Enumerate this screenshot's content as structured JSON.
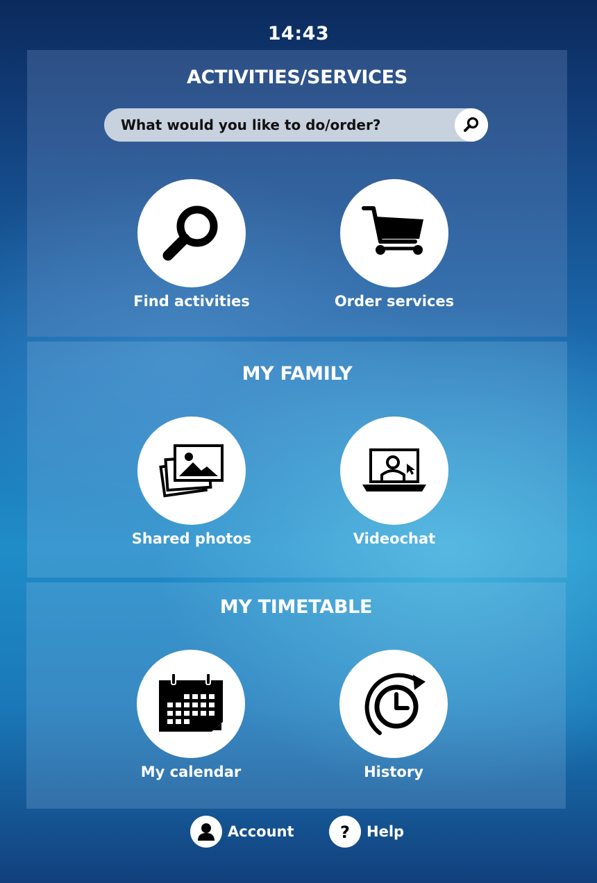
{
  "clock": "14:43",
  "sections": {
    "activities": {
      "title": "ACTIVITIES/SERVICES",
      "search_placeholder": "What would you like to do/order?",
      "tiles": [
        {
          "label": "Find activities",
          "icon": "magnifier-icon"
        },
        {
          "label": "Order services",
          "icon": "shopping-cart-icon"
        }
      ]
    },
    "family": {
      "title": "MY FAMILY",
      "tiles": [
        {
          "label": "Shared photos",
          "icon": "photo-stack-icon"
        },
        {
          "label": "Videochat",
          "icon": "laptop-person-icon"
        }
      ]
    },
    "timetable": {
      "title": "MY TIMETABLE",
      "tiles": [
        {
          "label": "My calendar",
          "icon": "calendar-icon"
        },
        {
          "label": "History",
          "icon": "history-clock-icon"
        }
      ]
    }
  },
  "footer": {
    "account_label": "Account",
    "help_label": "Help"
  },
  "colors": {
    "background_top": "#0b2a5c",
    "background_mid": "#1f8cc8",
    "search_bar": "#c8d1de",
    "circle": "#ffffff",
    "text": "#ffffff"
  }
}
